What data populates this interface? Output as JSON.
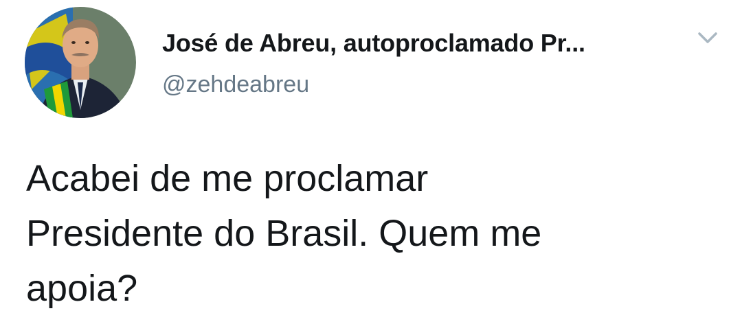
{
  "tweet": {
    "author": {
      "display_name": "José de Abreu, autoproclamado Pr...",
      "handle": "@zehdeabreu",
      "avatar_icon": "profile-photo"
    },
    "menu_icon": "chevron-down-icon",
    "text": "Acabei de me proclamar\nPresidente do Brasil. Quem me\napoia?"
  },
  "colors": {
    "text_primary": "#14171a",
    "text_secondary": "#657786",
    "chevron": "#aab8c2",
    "background": "#ffffff"
  }
}
